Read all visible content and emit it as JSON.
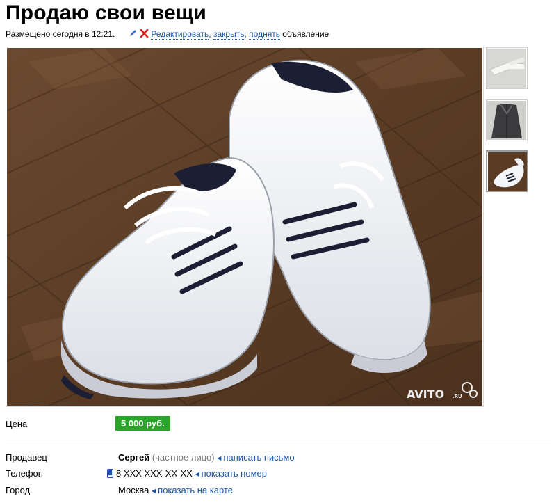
{
  "header": {
    "title": "Продаю свои вещи",
    "posted_text": "Размещено сегодня в 12:21.",
    "edit_link": "Редактировать",
    "close_link": "закрыть",
    "raise_link": "поднять",
    "ad_word": "объявление",
    "comma": ","
  },
  "photo": {
    "watermark_main": "AVITO",
    "watermark_suffix": ".RU"
  },
  "thumbnails": [
    {
      "name": "white-trousers",
      "active": false
    },
    {
      "name": "dark-coat",
      "active": false
    },
    {
      "name": "white-sneakers",
      "active": true
    }
  ],
  "details": {
    "price_label": "Цена",
    "price_value": "5 000 руб.",
    "seller_label": "Продавец",
    "seller_name": "Сергей",
    "seller_type": "(частное лицо)",
    "write_letter": "написать письмо",
    "phone_label": "Телефон",
    "phone_value": "8 XXX XXX-XX-XX",
    "show_number": "показать номер",
    "city_label": "Город",
    "city_value": "Москва",
    "show_map": "показать на карте"
  },
  "colors": {
    "link": "#1a55a8",
    "price_badge": "#2aa52a",
    "close_x": "#d9201a",
    "pencil": "#3a6fd0"
  },
  "icons": [
    "pencil-icon",
    "close-x-icon",
    "phone-icon",
    "arrow-left-icon"
  ]
}
